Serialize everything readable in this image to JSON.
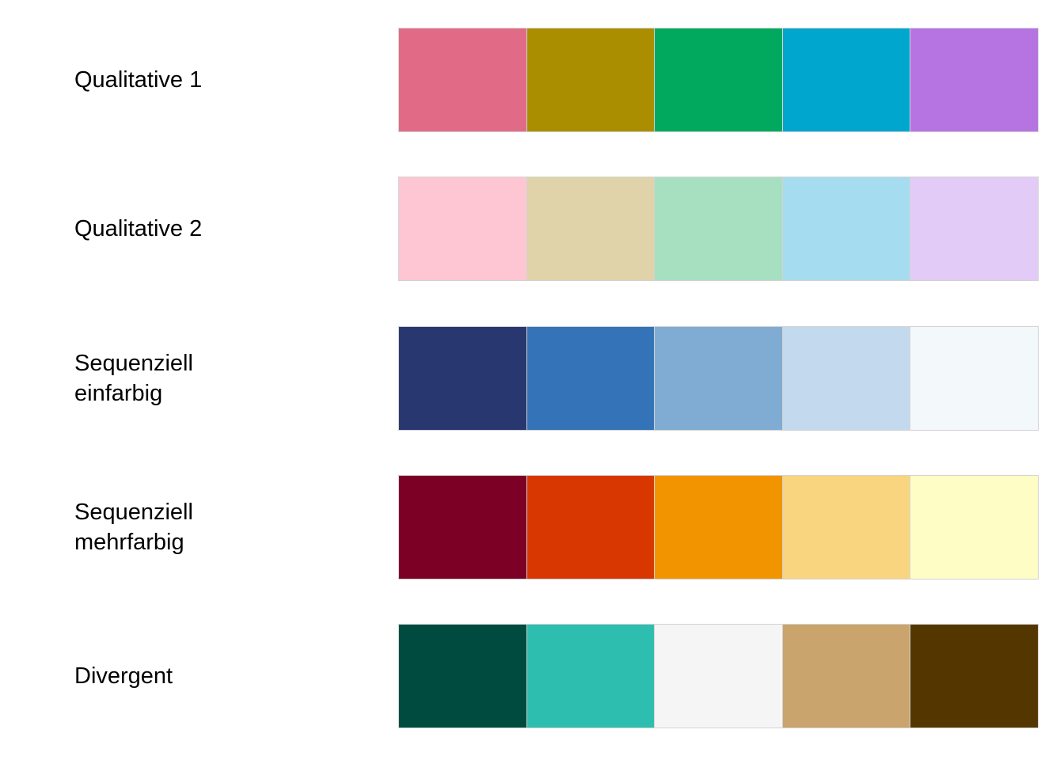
{
  "palettes": [
    {
      "label": "Qualitative 1",
      "colors": [
        "#e16b86",
        "#aa8e00",
        "#00a95d",
        "#00a6cd",
        "#b674e2"
      ]
    },
    {
      "label": "Qualitative 2",
      "colors": [
        "#fec6d3",
        "#e0d3a9",
        "#a6e0c1",
        "#a5dcef",
        "#e2cbf7"
      ]
    },
    {
      "label": "Sequenziell\neinfarbig",
      "colors": [
        "#283770",
        "#3473b7",
        "#80abd2",
        "#c3d9ed",
        "#f3f8fb"
      ]
    },
    {
      "label": "Sequenziell\nmehrfarbig",
      "colors": [
        "#7c0025",
        "#d93701",
        "#f29400",
        "#f8d57e",
        "#fefdc6"
      ]
    },
    {
      "label": "Divergent",
      "colors": [
        "#004b40",
        "#2ebeaf",
        "#f5f5f5",
        "#caa46d",
        "#543700"
      ]
    }
  ]
}
